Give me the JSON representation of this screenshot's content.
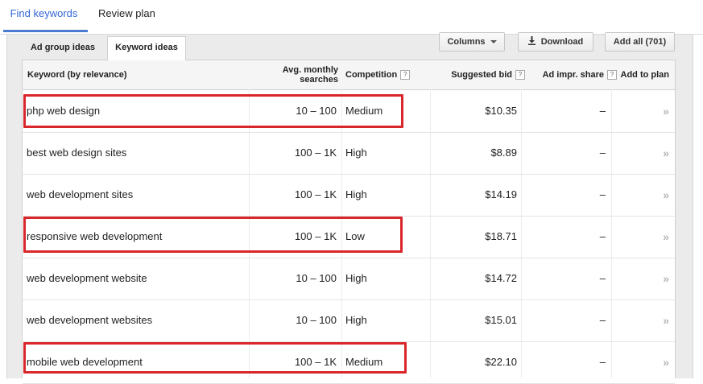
{
  "nav": {
    "find_keywords": "Find keywords",
    "review_plan": "Review plan"
  },
  "subtabs": {
    "ad_group_ideas": "Ad group ideas",
    "keyword_ideas": "Keyword ideas"
  },
  "toolbar": {
    "columns": "Columns",
    "download": "Download",
    "add_all": "Add all (701)"
  },
  "table": {
    "headers": {
      "keyword": "Keyword (by relevance)",
      "searches_line1": "Avg. monthly",
      "searches_line2": "searches",
      "competition": "Competition",
      "bid": "Suggested bid",
      "impr": "Ad impr. share",
      "plan": "Add to plan",
      "help": "?"
    },
    "rows": [
      {
        "keyword": "php web design",
        "searches": "10 – 100",
        "competition": "Medium",
        "bid": "$10.35",
        "impr": "–",
        "plan": "»"
      },
      {
        "keyword": "best web design sites",
        "searches": "100 – 1K",
        "competition": "High",
        "bid": "$8.89",
        "impr": "–",
        "plan": "»"
      },
      {
        "keyword": "web development sites",
        "searches": "100 – 1K",
        "competition": "High",
        "bid": "$14.19",
        "impr": "–",
        "plan": "»"
      },
      {
        "keyword": "responsive web development",
        "searches": "100 – 1K",
        "competition": "Low",
        "bid": "$18.71",
        "impr": "–",
        "plan": "»"
      },
      {
        "keyword": "web development website",
        "searches": "10 – 100",
        "competition": "High",
        "bid": "$14.72",
        "impr": "–",
        "plan": "»"
      },
      {
        "keyword": "web development websites",
        "searches": "10 – 100",
        "competition": "High",
        "bid": "$15.01",
        "impr": "–",
        "plan": "»"
      },
      {
        "keyword": "mobile web development",
        "searches": "100 – 1K",
        "competition": "Medium",
        "bid": "$22.10",
        "impr": "–",
        "plan": "»"
      }
    ]
  },
  "colors": {
    "accent": "#3367d6",
    "highlight": "#d9262b",
    "panel": "#ebebeb"
  },
  "icons": {
    "download": "download-icon",
    "columns_dropdown": "caret-down-icon",
    "add_to_plan": "double-chevron-icon"
  }
}
